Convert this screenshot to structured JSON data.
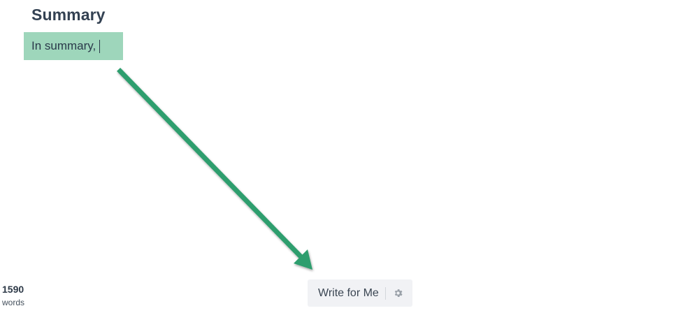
{
  "section": {
    "heading": "Summary"
  },
  "editor": {
    "text": "In summary,"
  },
  "word_count": {
    "value": "1590",
    "label": "words"
  },
  "write_button": {
    "label": "Write for Me",
    "settings_icon": "gear-icon"
  },
  "colors": {
    "highlight": "#9ed6bb",
    "arrow": "#2f9e6e",
    "button_bg": "#f1f2f5"
  }
}
